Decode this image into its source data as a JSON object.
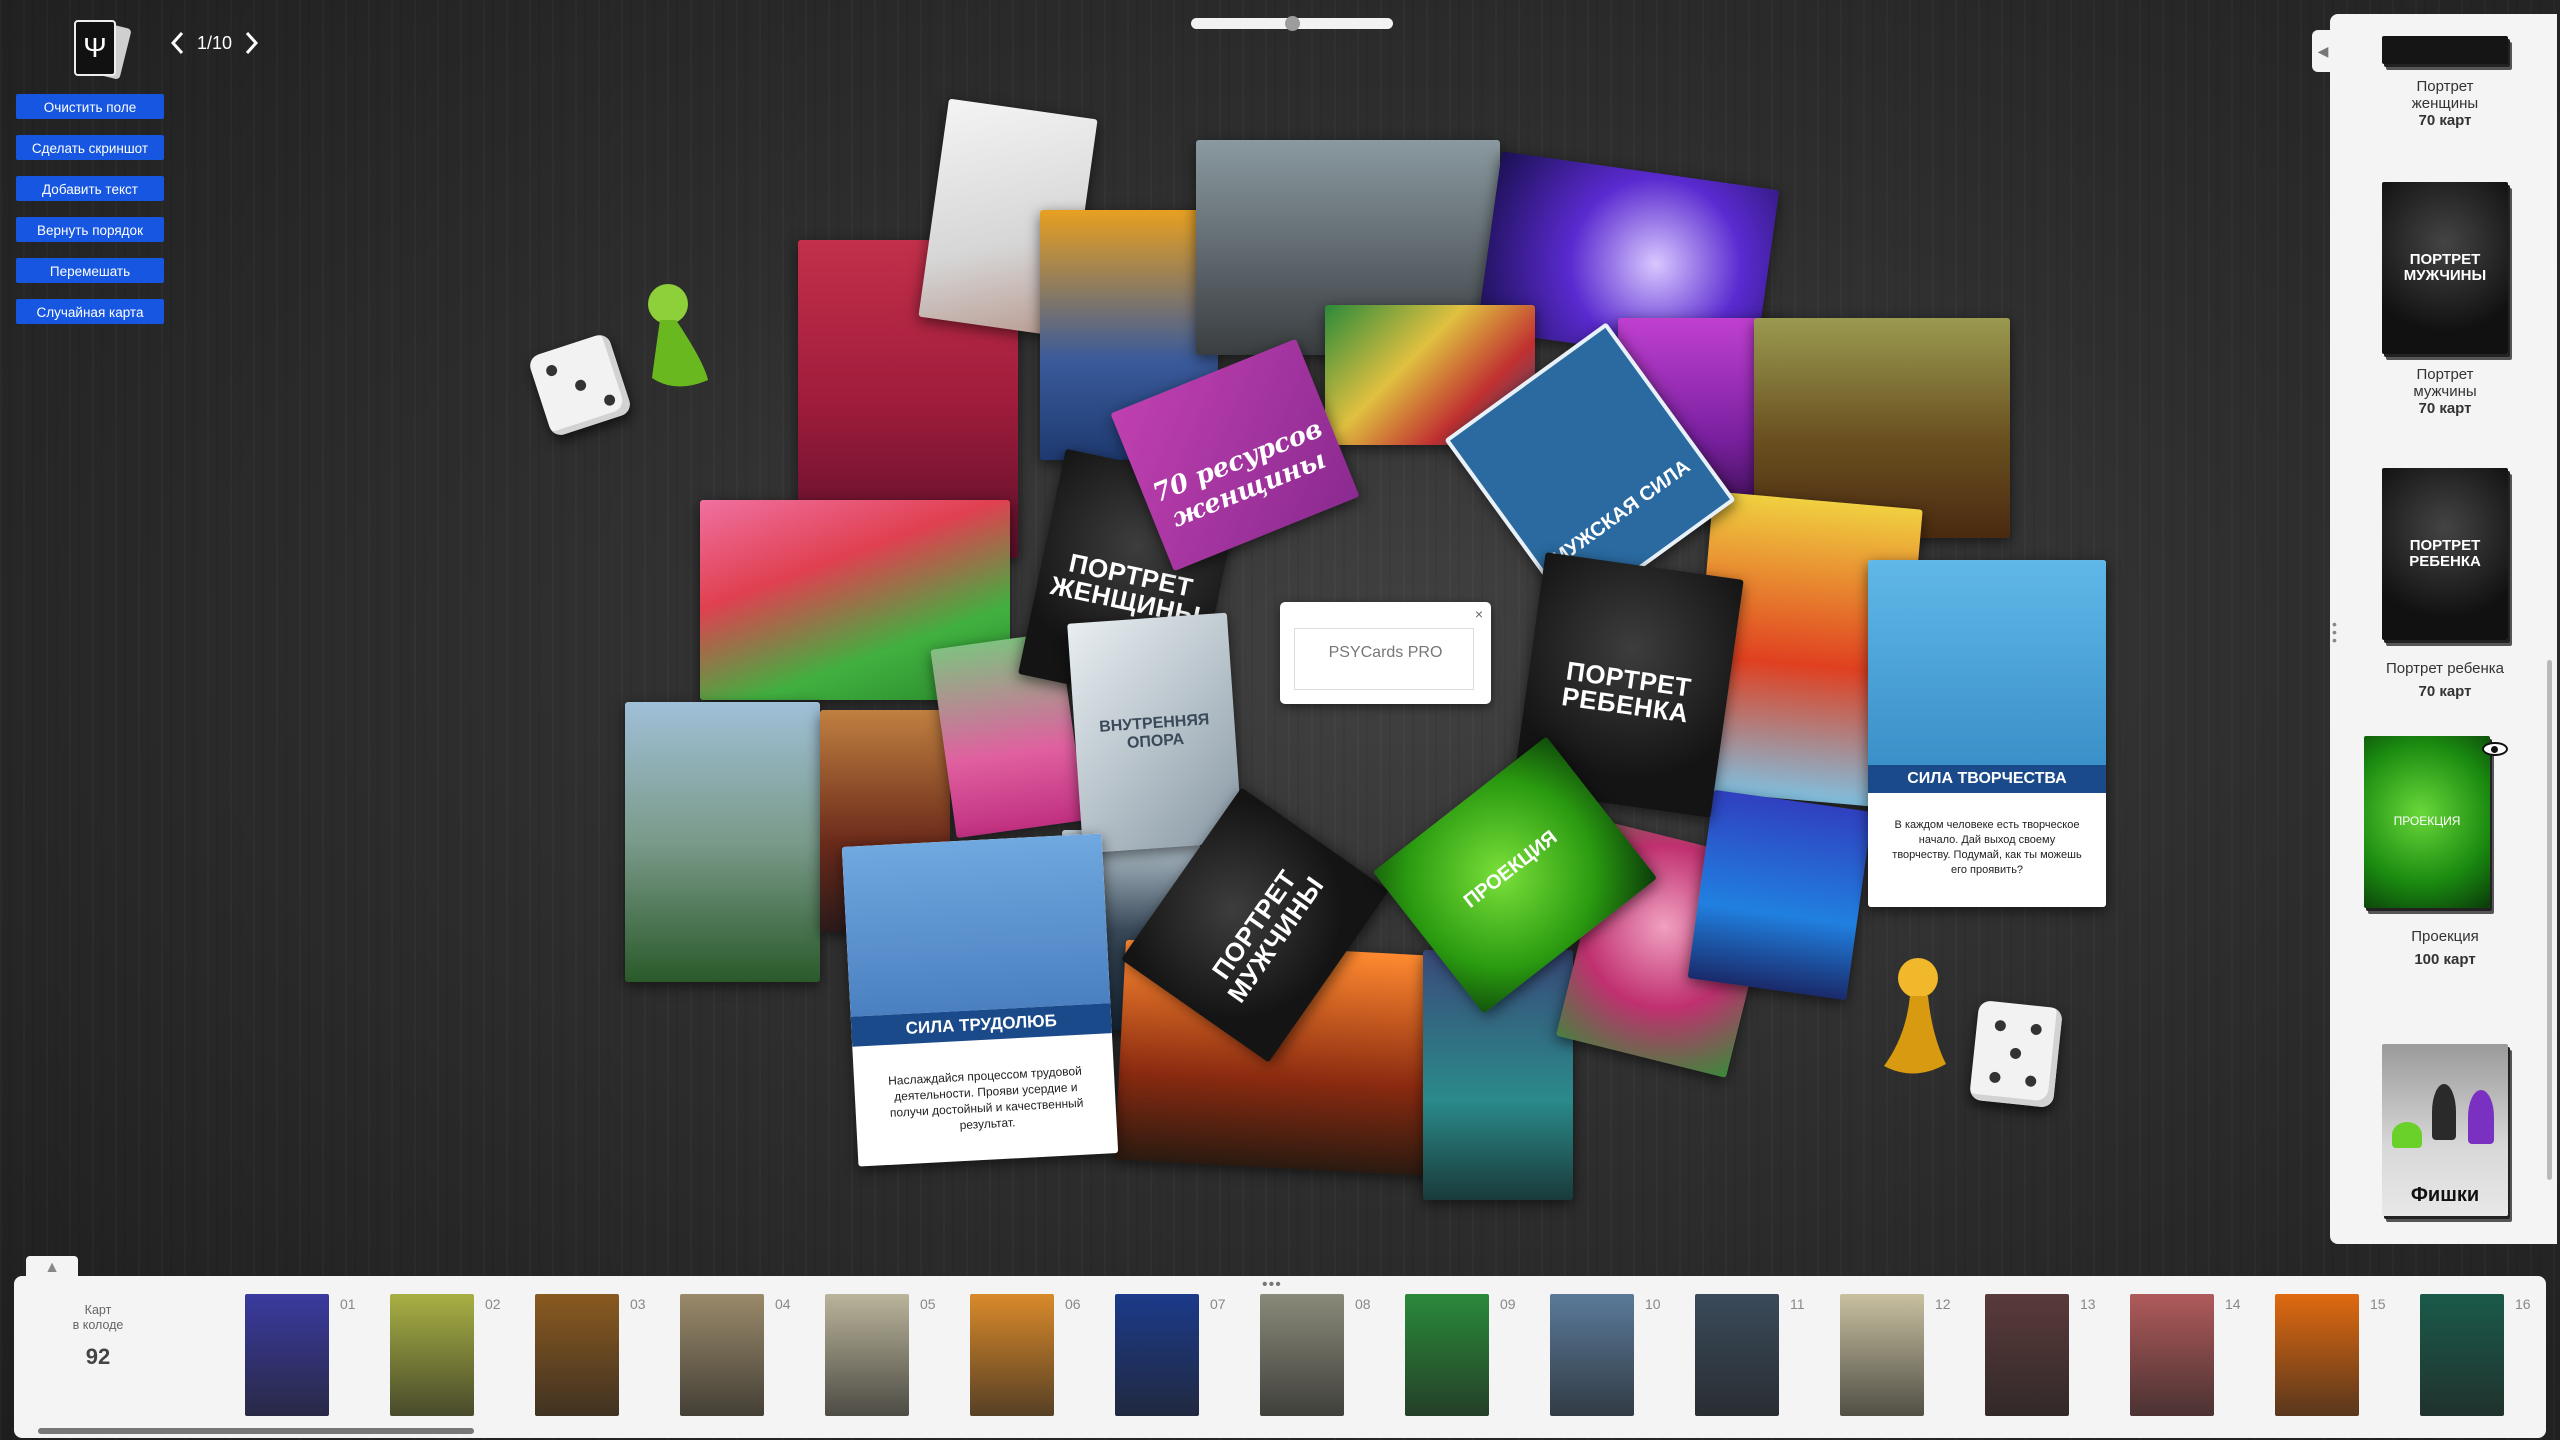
{
  "header": {
    "logo_glyph": "Ψ",
    "page_current": "1/10"
  },
  "toolbar": {
    "buttons": [
      "Очистить поле",
      "Сделать скриншот",
      "Добавить текст",
      "Вернуть порядок",
      "Перемешать",
      "Случайная карта"
    ]
  },
  "board": {
    "deck_cards": {
      "woman": "ПОРТРЕТ ЖЕНЩИНЫ",
      "man": "ПОРТРЕТ МУЖЧИНЫ",
      "child": "ПОРТРЕТ РЕБЕНКА",
      "inner": "ВНУТРЕННЯЯ ОПОРА",
      "projection": "ПРОЕКЦИЯ",
      "seventy": "70 ресурсов женщины",
      "male_power": "МУЖСКАЯ СИЛА"
    },
    "cards": {
      "creativity_title": "СИЛА ТВОРЧЕСТВА",
      "creativity_text": "В каждом человеке есть творческое начало. Дай выход своему творчеству. Подумай, как ты можешь его проявить?",
      "diligence_title": "СИЛА ТРУДОЛЮБ",
      "diligence_text": "Наслаждайся процессом трудовой деятельности. Прояви усердие и получи достойный и качественный результат."
    },
    "textbox": {
      "title": "PSYCards PRO",
      "close": "×"
    }
  },
  "right_panel": {
    "toggle": "◀",
    "decks": [
      {
        "name": "Портрет женщины",
        "count": "70 карт"
      },
      {
        "name": "Портрет мужчины",
        "count": "70 карт",
        "cover": "ПОРТРЕТ МУЖЧИНЫ"
      },
      {
        "name": "Портрет ребенка",
        "count": "70 карт",
        "cover": "ПОРТРЕТ РЕБЕНКА"
      },
      {
        "name": "Проекция",
        "count": "100 карт",
        "cover": "ПРОЕКЦИЯ"
      },
      {
        "cover": "Фишки"
      }
    ]
  },
  "tray": {
    "toggle": "▲",
    "counter_label_1": "Карт",
    "counter_label_2": "в колоде",
    "counter_value": "92",
    "thumbs": [
      {
        "num": "01",
        "color": "#3a3aa0"
      },
      {
        "num": "02",
        "color": "#a8b043"
      },
      {
        "num": "03",
        "color": "#8a5a20"
      },
      {
        "num": "04",
        "color": "#9a8a6a"
      },
      {
        "num": "05",
        "color": "#b9b49a"
      },
      {
        "num": "06",
        "color": "#d98a2a"
      },
      {
        "num": "07",
        "color": "#1c3a8a"
      },
      {
        "num": "08",
        "color": "#8a8a7a"
      },
      {
        "num": "09",
        "color": "#2a8a3a"
      },
      {
        "num": "10",
        "color": "#5a7a9a"
      },
      {
        "num": "11",
        "color": "#3a4a5a"
      },
      {
        "num": "12",
        "color": "#c8c0a0"
      },
      {
        "num": "13",
        "color": "#5a3a3a"
      },
      {
        "num": "14",
        "color": "#b05a5a"
      },
      {
        "num": "15",
        "color": "#e06a10"
      },
      {
        "num": "16",
        "color": "#1a5a4a"
      }
    ]
  }
}
